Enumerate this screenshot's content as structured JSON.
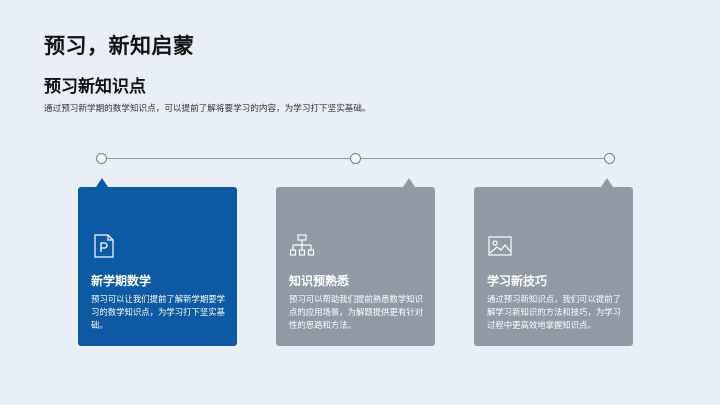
{
  "page": {
    "title": "预习，新知启蒙",
    "subtitle": "预习新知识点",
    "description": "通过预习新学期的数学知识点，可以提前了解将要学习的内容，为学习打下坚实基础。"
  },
  "cards": [
    {
      "title": "新学期数学",
      "text": "预习可以让我们提前了解新学期要学习的数学知识点，为学习打下坚实基础。",
      "icon": "document-p-icon",
      "color": "#0b5aa3"
    },
    {
      "title": "知识预熟悉",
      "text": "预习可以帮助我们提前熟悉数学知识点的应用场景，为解题提供更有针对性的思路和方法。",
      "icon": "hierarchy-icon",
      "color": "#8f9aa6"
    },
    {
      "title": "学习新技巧",
      "text": "通过预习新知识点，我们可以提前了解学习新知识的方法和技巧，为学习过程中更高效地掌握知识点。",
      "icon": "image-icon",
      "color": "#8f9aa6"
    }
  ]
}
